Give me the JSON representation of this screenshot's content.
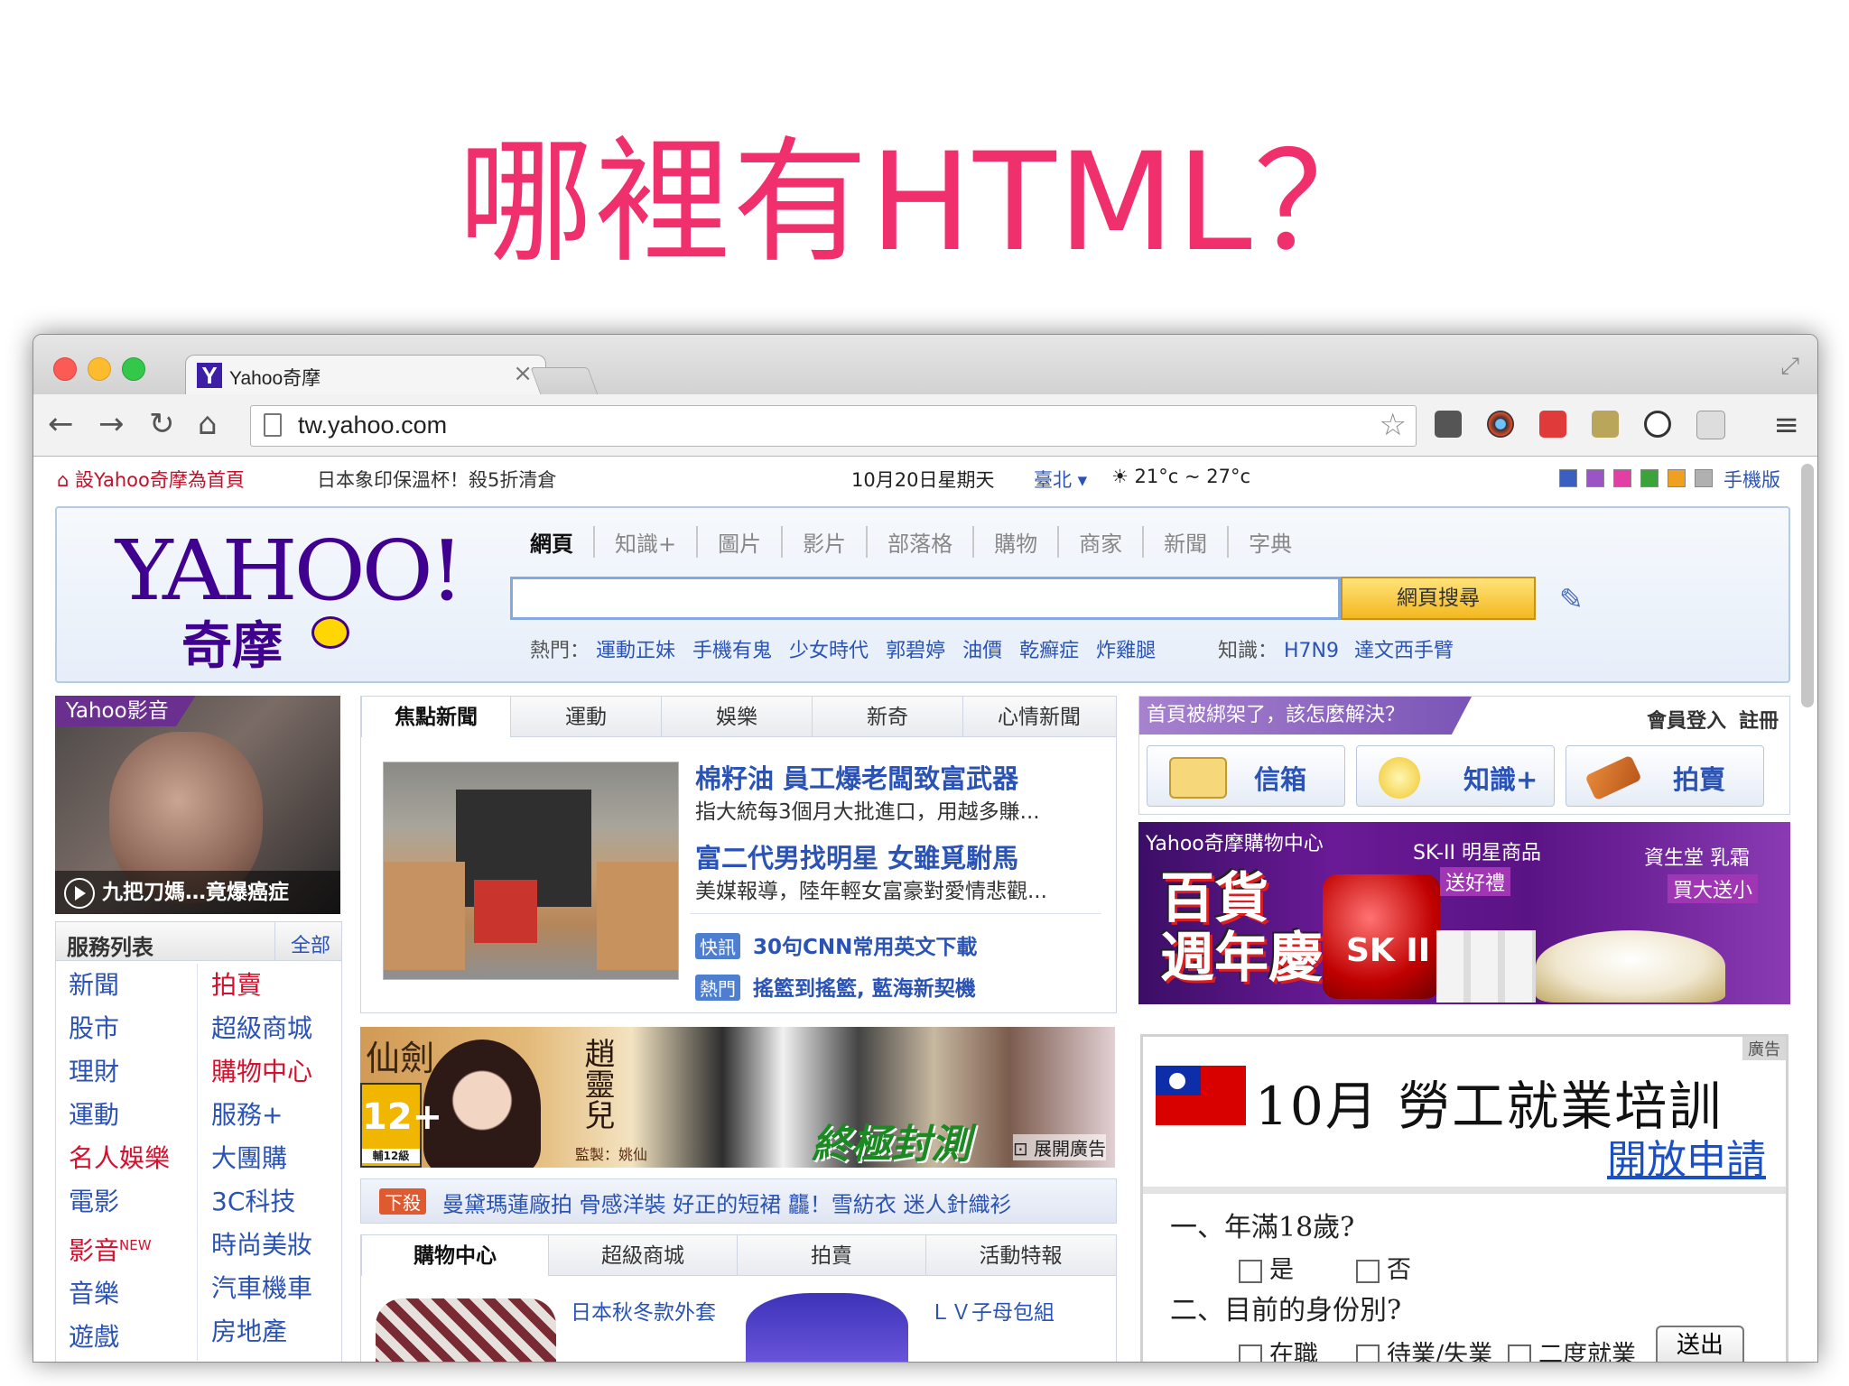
{
  "slide": {
    "title": "哪裡有HTML？"
  },
  "browser": {
    "tab_title": "Yahoo奇摩",
    "tab_favicon": "Y",
    "url": "tw.yahoo.com"
  },
  "topbar": {
    "set_home": "設Yahoo奇摩為首頁",
    "promo": "日本象印保溫杯！殺5折清倉",
    "date": "10月20日星期天",
    "city": "臺北",
    "temp": "21°c ~ 27°c",
    "mobile": "手機版",
    "theme_colors": [
      "#3b5fc0",
      "#9b54c4",
      "#e23ea4",
      "#3aa43a",
      "#f0a020",
      "#b0b0b0"
    ]
  },
  "search": {
    "logo_text": "YAHOO!",
    "logo_cn": "奇摩",
    "tabs": [
      "網頁",
      "知識+",
      "圖片",
      "影片",
      "部落格",
      "購物",
      "商家",
      "新聞",
      "字典"
    ],
    "button": "網頁搜尋",
    "hot_label": "熱門：",
    "hot": [
      "運動正妹",
      "手機有鬼",
      "少女時代",
      "郭碧婷",
      "油價",
      "乾癬症",
      "炸雞腿"
    ],
    "know_label": "知識：",
    "know": [
      "H7N9",
      "達文西手臂"
    ]
  },
  "video": {
    "tag": "Yahoo影音",
    "caption": "九把刀媽…竟爆癌症"
  },
  "services": {
    "title": "服務列表",
    "all": "全部",
    "col1": [
      "新聞",
      "股市",
      "理財",
      "運動",
      "名人娛樂",
      "電影",
      "影音",
      "音樂",
      "遊戲"
    ],
    "col2": [
      "拍賣",
      "超級商城",
      "購物中心",
      "服務+",
      "大團購",
      "3C科技",
      "時尚美妝",
      "汽車機車",
      "房地產"
    ],
    "new_badge": "NEW"
  },
  "news": {
    "tabs": [
      "焦點新聞",
      "運動",
      "娛樂",
      "新奇",
      "心情新聞"
    ],
    "h1": "棉籽油 員工爆老闆致富武器",
    "s1": "指大統每3個月大批進口，用越多賺...",
    "h2": "富二代男找明星 女雖覓駙馬",
    "s2": "美媒報導，陸年輕女富豪對愛情悲觀...",
    "badge1": "快訊",
    "b1": "30句CNN常用英文下載",
    "badge2": "熱門",
    "b2": "搖籃到搖籃, 藍海新契機"
  },
  "game_ad": {
    "logo": "仙劍",
    "rating": "12+",
    "rating_sub": "輔12級",
    "name": "趙靈兒",
    "producer": "監製：姚仙",
    "slogan": "終極封測",
    "expand": "展開廣告"
  },
  "promo": {
    "tag": "下殺",
    "text": "曼黛瑪蓮廠拍  骨感洋裝  好正的短裙  龘！雪紡衣  迷人針織衫"
  },
  "shop": {
    "tabs": [
      "購物中心",
      "超級商城",
      "拍賣",
      "活動特報"
    ],
    "item1": "日本秋冬款外套",
    "item2": "ＬＶ子母包組"
  },
  "account": {
    "banner": "首頁被綁架了，該怎麼解決？",
    "login": "會員登入",
    "register": "註冊",
    "buttons": [
      "信箱",
      "知識+",
      "拍賣"
    ]
  },
  "sk_ad": {
    "mall": "Yahoo奇摩購物中心",
    "big1": "百貨",
    "big2": "週年慶",
    "jar_text": "SK II",
    "t1": "SK-II 明星商品",
    "t2": "送好禮",
    "t3": "資生堂 乳霜",
    "t4": "買大送小"
  },
  "job_ad": {
    "ad_label": "廣告",
    "title": "10月 勞工就業培訓",
    "apply": "開放申請",
    "q1": "一、年滿18歲?",
    "q1_opts": [
      "是",
      "否"
    ],
    "q2": "二、目前的身份別?",
    "q2_opts": [
      "在職",
      "待業/失業",
      "二度就業"
    ],
    "submit": "送出"
  }
}
